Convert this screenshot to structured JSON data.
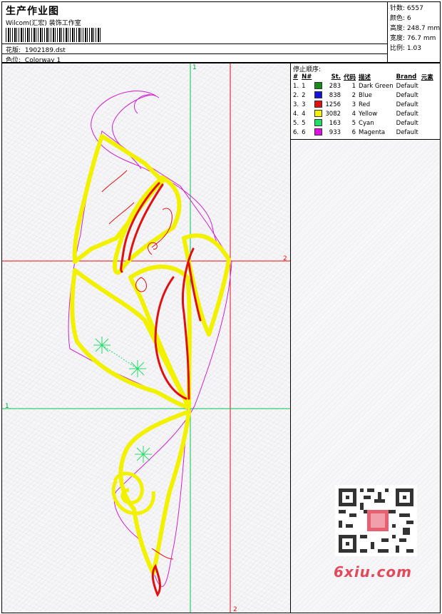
{
  "header": {
    "title": "生产作业图",
    "company": "Wilcom(汇宏) 装饰工作室",
    "design_label": "花版:",
    "design_file": "1902189.dst",
    "colorway_label": "色位:",
    "colorway": "Colorway 1"
  },
  "stats": [
    {
      "label": "针数:",
      "value": "6557"
    },
    {
      "label": "颜色:",
      "value": "6"
    },
    {
      "label": "高度:",
      "value": "248.7 mm"
    },
    {
      "label": "宽度:",
      "value": "76.7 mm"
    },
    {
      "label": "比例:",
      "value": "1.03"
    }
  ],
  "stop_sequence": {
    "title": "停止顺序:",
    "headers": [
      "#",
      "N#",
      "St.",
      "代码",
      "描述",
      "Brand",
      "元素"
    ],
    "rows": [
      {
        "num": "1.",
        "n": "1",
        "color": "#1a8a1a",
        "st": "283",
        "code": "1",
        "desc": "Dark Green",
        "brand": "Default"
      },
      {
        "num": "2.",
        "n": "2",
        "color": "#1414d8",
        "st": "838",
        "code": "2",
        "desc": "Blue",
        "brand": "Default"
      },
      {
        "num": "3.",
        "n": "3",
        "color": "#e01010",
        "st": "1256",
        "code": "3",
        "desc": "Red",
        "brand": "Default"
      },
      {
        "num": "4.",
        "n": "4",
        "color": "#f2f200",
        "st": "3082",
        "code": "4",
        "desc": "Yellow",
        "brand": "Default"
      },
      {
        "num": "5.",
        "n": "5",
        "color": "#22dd66",
        "st": "163",
        "code": "5",
        "desc": "Cyan",
        "brand": "Default"
      },
      {
        "num": "6.",
        "n": "6",
        "color": "#e010e0",
        "st": "933",
        "code": "6",
        "desc": "Magenta",
        "brand": "Default"
      }
    ]
  },
  "axis_labels": {
    "top": "1",
    "bottom": "2",
    "right": "2",
    "left": "1"
  },
  "colors": {
    "guide_red": "#e01010",
    "guide_green": "#00c84a",
    "yellow": "#f2f200",
    "magenta": "#d020d0",
    "red": "#e01010",
    "green": "#22dd66"
  },
  "watermark": "6xiu.com"
}
